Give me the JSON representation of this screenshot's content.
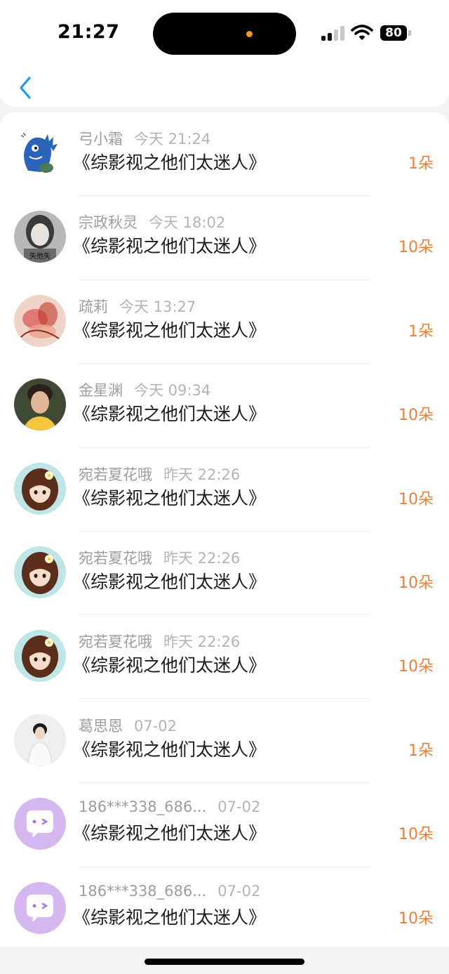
{
  "status_bar": {
    "time": "21:27",
    "battery": "80"
  },
  "colors": {
    "accent": "#1f95ef",
    "count": "#ec7f38",
    "meta": "#a3a3a8",
    "title": "#1a1a1a"
  },
  "rows": [
    {
      "avatar": "avatar-dinosaur-cartoon",
      "user": "弓小霜",
      "time": "今天 21:24",
      "title": "《综影视之他们太迷人》",
      "count": "1朵"
    },
    {
      "avatar": "avatar-girl-photo",
      "user": "宗政秋灵",
      "time": "今天 18:02",
      "title": "《综影视之他们太迷人》",
      "count": "10朵"
    },
    {
      "avatar": "avatar-flower-painting",
      "user": "疏莉",
      "time": "今天 13:27",
      "title": "《综影视之他们太迷人》",
      "count": "1朵"
    },
    {
      "avatar": "avatar-man-photo",
      "user": "金星渊",
      "time": "今天 09:34",
      "title": "《综影视之他们太迷人》",
      "count": "10朵"
    },
    {
      "avatar": "avatar-anime-girl",
      "user": "宛若夏花哦",
      "time": "昨天 22:26",
      "title": "《综影视之他们太迷人》",
      "count": "10朵"
    },
    {
      "avatar": "avatar-anime-girl",
      "user": "宛若夏花哦",
      "time": "昨天 22:26",
      "title": "《综影视之他们太迷人》",
      "count": "10朵"
    },
    {
      "avatar": "avatar-anime-girl",
      "user": "宛若夏花哦",
      "time": "昨天 22:26",
      "title": "《综影视之他们太迷人》",
      "count": "10朵"
    },
    {
      "avatar": "avatar-boy-photo",
      "user": "葛思恩",
      "time": "07-02",
      "title": "《综影视之他们太迷人》",
      "count": "1朵"
    },
    {
      "avatar": "avatar-default-chat",
      "user": "186***338_686...",
      "time": "07-02",
      "title": "《综影视之他们太迷人》",
      "count": "10朵"
    },
    {
      "avatar": "avatar-default-chat",
      "user": "186***338_686...",
      "time": "07-02",
      "title": "《综影视之他们太迷人》",
      "count": "10朵"
    }
  ]
}
